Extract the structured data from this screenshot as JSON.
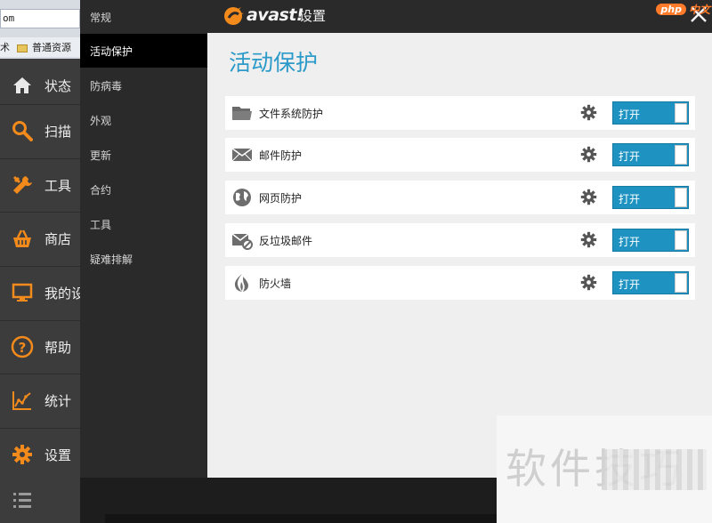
{
  "browser": {
    "address_text": "om",
    "bookmark_prefix": "术",
    "bookmark_label": "普通资源"
  },
  "window": {
    "brand": "avast!",
    "title": "设置"
  },
  "badge": {
    "pill": "php",
    "text": "中文"
  },
  "main_nav": [
    {
      "label": "状态",
      "icon": "home-icon"
    },
    {
      "label": "扫描",
      "icon": "search-icon"
    },
    {
      "label": "工具",
      "icon": "tools-icon"
    },
    {
      "label": "商店",
      "icon": "basket-icon"
    },
    {
      "label": "我的设",
      "icon": "monitor-icon"
    },
    {
      "label": "帮助",
      "icon": "help-icon"
    },
    {
      "label": "统计",
      "icon": "stats-icon"
    },
    {
      "label": "设置",
      "icon": "gear-icon"
    }
  ],
  "sub_nav": [
    {
      "label": "常规"
    },
    {
      "label": "活动保护",
      "active": true
    },
    {
      "label": "防病毒"
    },
    {
      "label": "外观"
    },
    {
      "label": "更新"
    },
    {
      "label": "合约"
    },
    {
      "label": "工具"
    },
    {
      "label": "疑难排解"
    }
  ],
  "page": {
    "title": "活动保护"
  },
  "shields": [
    {
      "label": "文件系统防护",
      "icon": "folder-icon",
      "status": "打开"
    },
    {
      "label": "邮件防护",
      "icon": "mail-icon",
      "status": "打开"
    },
    {
      "label": "网页防护",
      "icon": "globe-icon",
      "status": "打开"
    },
    {
      "label": "反垃圾邮件",
      "icon": "antispam-mail-icon",
      "status": "打开"
    },
    {
      "label": "防火墙",
      "icon": "fire-icon",
      "status": "打开"
    }
  ],
  "watermark": {
    "text": "软件技巧"
  },
  "colors": {
    "accent": "#2b9ac9",
    "toggle_on": "#1e93c2",
    "nav_icon": "#f28a1c"
  }
}
